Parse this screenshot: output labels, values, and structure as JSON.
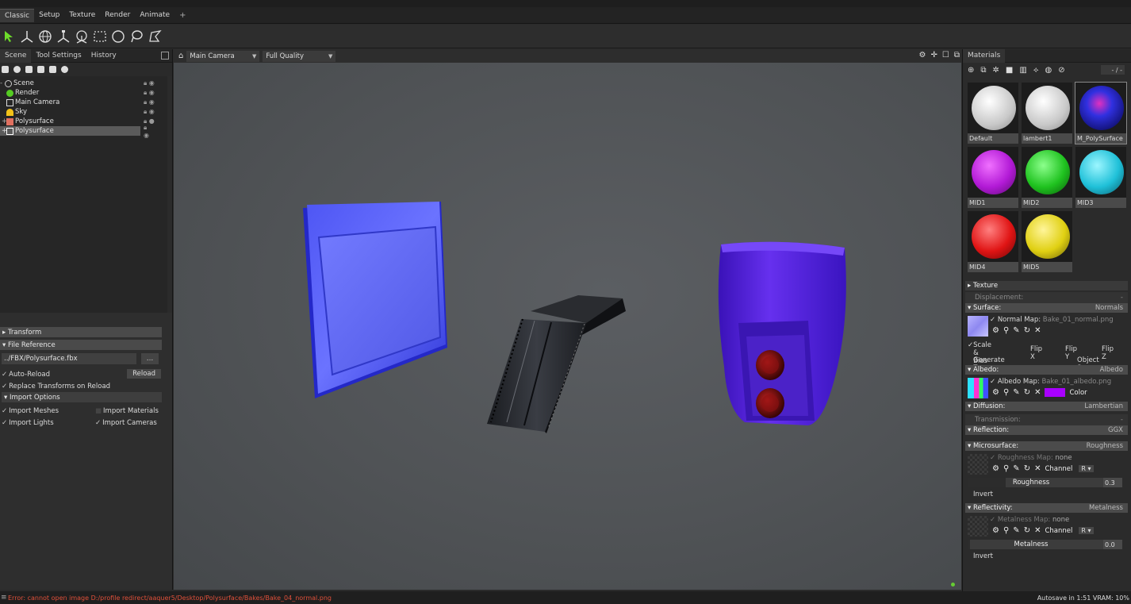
{
  "menu": {
    "tabs": [
      "Classic",
      "Setup",
      "Texture",
      "Render",
      "Animate",
      "+"
    ]
  },
  "left_panel": {
    "tabs": [
      "Scene",
      "Tool Settings",
      "History"
    ],
    "tree": [
      {
        "label": "Scene",
        "icon": "scene-icon"
      },
      {
        "label": "Render",
        "icon": "render-icon"
      },
      {
        "label": "Main Camera",
        "icon": "camera-icon"
      },
      {
        "label": "Sky",
        "icon": "sky-icon"
      },
      {
        "label": "Polysurface",
        "icon": "mesh-icon"
      },
      {
        "label": "Polysurface",
        "icon": "mesh-icon",
        "selected": true
      }
    ],
    "transform_label": "Transform",
    "file_reference_label": "File Reference",
    "file_path": "../FBX/Polysurface.fbx",
    "browse_label": "...",
    "auto_reload_label": "Auto-Reload",
    "reload_button": "Reload",
    "replace_transforms_label": "Replace Transforms on Reload",
    "import_options_label": "Import Options",
    "import_meshes_label": "Import Meshes",
    "import_materials_label": "Import Materials",
    "import_lights_label": "Import Lights",
    "import_cameras_label": "Import Cameras"
  },
  "viewport": {
    "camera": "Main Camera",
    "quality": "Full Quality"
  },
  "right_panel": {
    "tab": "Materials",
    "counter": "- / -",
    "materials": [
      {
        "name": "Default",
        "color": "#f2f2f2"
      },
      {
        "name": "lambert1",
        "color": "#f2f2f2"
      },
      {
        "name": "M_PolySurface",
        "color": "#2b18c8"
      },
      {
        "name": "MID1",
        "color": "#b21ad6"
      },
      {
        "name": "MID2",
        "color": "#1fc21f"
      },
      {
        "name": "MID3",
        "color": "#1fc0d8"
      },
      {
        "name": "MID4",
        "color": "#e01414"
      },
      {
        "name": "MID5",
        "color": "#e0d012"
      }
    ],
    "texture_label": "Texture",
    "displacement_label": "Displacement:",
    "displacement_value": "-",
    "surface_label": "Surface:",
    "surface_value": "Normals",
    "normal_map_label": "Normal Map:",
    "normal_map_file": "Bake_01_normal.png",
    "scale_bias_label": "Scale & Bias",
    "flip_x_label": "Flip X",
    "flip_y_label": "Flip Y",
    "flip_z_label": "Flip Z",
    "generate_z_label": "Generate Z",
    "object_space_label": "Object Space",
    "albedo_label": "Albedo:",
    "albedo_value": "Albedo",
    "albedo_map_label": "Albedo Map:",
    "albedo_map_file": "Bake_01_albedo.png",
    "color_label": "Color",
    "albedo_color": "#a800ff",
    "diffusion_label": "Diffusion:",
    "diffusion_value": "Lambertian",
    "transmission_label": "Transmission:",
    "transmission_value": "-",
    "reflection_label": "Reflection:",
    "reflection_value": "GGX",
    "microsurface_label": "Microsurface:",
    "microsurface_value": "Roughness",
    "roughness_map_label": "Roughness Map:",
    "roughness_map_file": "none",
    "channel_label": "Channel",
    "channel_value_r": "R",
    "roughness_label": "Roughness",
    "roughness_value": "0.3",
    "invert_label": "Invert",
    "reflectivity_label": "Reflectivity:",
    "reflectivity_value": "Metalness",
    "metalness_map_label": "Metalness Map:",
    "metalness_map_file": "none",
    "metalness_label": "Metalness",
    "metalness_value": "0.0"
  },
  "status": {
    "error": "Error: cannot open image D:/profile redirect/aaquer5/Desktop/Polysurface/Bakes/Bake_04_normal.png",
    "right": "Autosave in 1:51  VRAM: 10%"
  }
}
